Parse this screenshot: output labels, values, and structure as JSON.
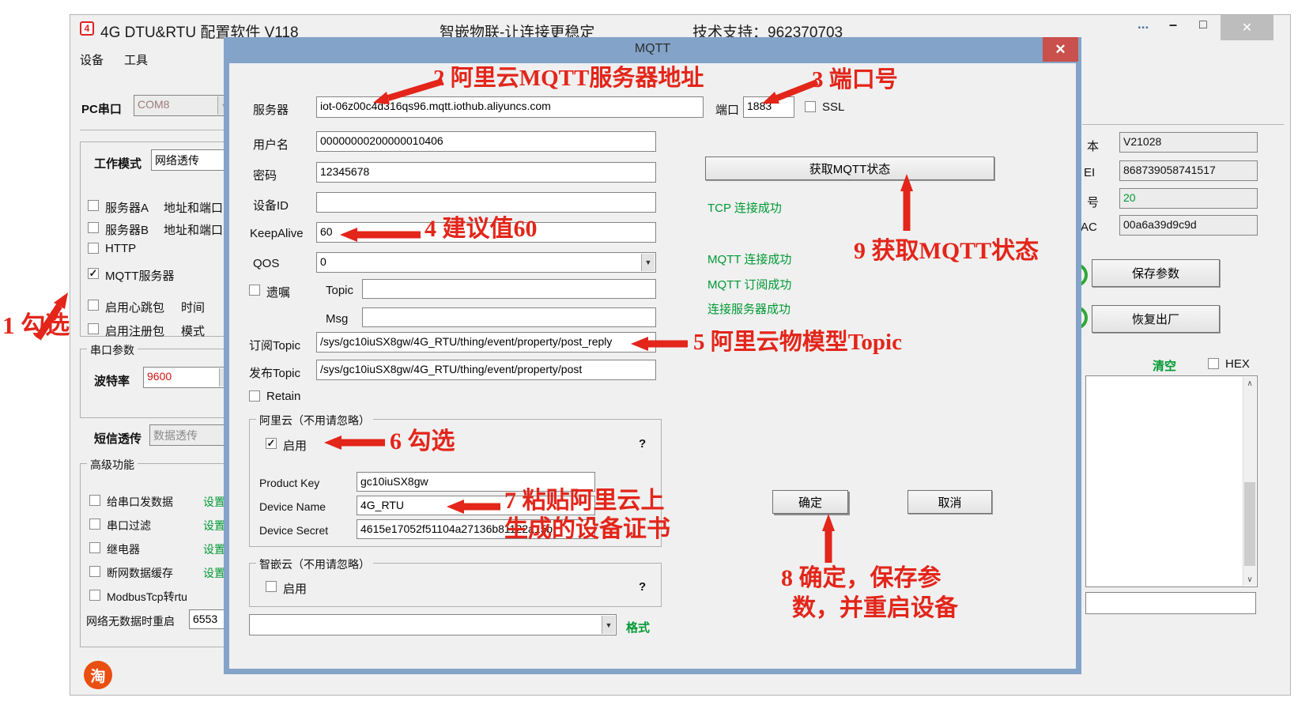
{
  "window": {
    "logo": "4",
    "title": "4G DTU&RTU 配置软件  V118",
    "subtitle": "智嵌物联-让连接更稳定",
    "support": "技术支持：962370703",
    "more": "...",
    "minimize": "–",
    "maximize": "□",
    "close": "✕",
    "menu": [
      {
        "label": "设备"
      },
      {
        "label": "工具"
      }
    ]
  },
  "icons": {
    "check": "✓",
    "dropdown_arrow": "▼",
    "help": "?",
    "scroll_up": "∧",
    "scroll_down": "∨",
    "taobao": "淘"
  },
  "left_panel": {
    "pc_serial_label": "PC串口",
    "pc_serial_value": "COM8",
    "work_mode_label": "工作模式",
    "work_mode_value": "网络透传",
    "server_a_label": "服务器A",
    "server_a_extra": "地址和端口",
    "server_b_label": "服务器B",
    "server_b_extra": "地址和端口",
    "http_label": "HTTP",
    "mqtt_server_label": "MQTT服务器",
    "heartbeat_label": "启用心跳包",
    "heartbeat_extra": "时间",
    "register_label": "启用注册包",
    "register_extra": "模式",
    "serial_group_title": "串口参数",
    "baud_label": "波特率",
    "baud_value": "9600",
    "sms_label": "短信透传",
    "sms_value": "数据透传",
    "advanced_group_title": "高级功能",
    "advanced_rows": [
      {
        "label": "给串口发数据",
        "link": "设置"
      },
      {
        "label": "串口过滤",
        "link": "设置"
      },
      {
        "label": "继电器",
        "link": "设置动"
      },
      {
        "label": "断网数据缓存",
        "link": "设置"
      },
      {
        "label": "ModbusTcp转rtu",
        "link": ""
      }
    ],
    "restart_label": "网络无数据时重启",
    "restart_value": "6553"
  },
  "dialog": {
    "title": "MQTT",
    "close": "✕",
    "server_label": "服务器",
    "server_value": "iot-06z00c4d316qs96.mqtt.iothub.aliyuncs.com",
    "port_label": "端口",
    "port_value": "1883",
    "ssl_label": "SSL",
    "username_label": "用户名",
    "username_value": "00000000200000010406",
    "password_label": "密码",
    "password_value": "12345678",
    "device_id_label": "设备ID",
    "device_id_value": "",
    "keepalive_label": "KeepAlive",
    "keepalive_value": "60",
    "qos_label": "QOS",
    "qos_value": "0",
    "will_label": "遗嘱",
    "will_topic_label": "Topic",
    "will_topic_value": "",
    "will_msg_label": "Msg",
    "will_msg_value": "",
    "sub_topic_label": "订阅Topic",
    "sub_topic_value": "/sys/gc10iuSX8gw/4G_RTU/thing/event/property/post_reply",
    "pub_topic_label": "发布Topic",
    "pub_topic_value": "/sys/gc10iuSX8gw/4G_RTU/thing/event/property/post",
    "retain_label": "Retain",
    "aliyun_group_title": "阿里云（不用请忽略）",
    "aliyun_enable_label": "启用",
    "product_key_label": "Product Key",
    "product_key_value": "gc10iuSX8gw",
    "device_name_label": "Device Name",
    "device_name_value": "4G_RTU",
    "device_secret_label": "Device Secret",
    "device_secret_value": "4615e17052f51104a27136b81122a15b",
    "zhiqian_group_title": "智嵌云（不用请忽略）",
    "zhiqian_enable_label": "启用",
    "format_label": "格式",
    "status_button": "获取MQTT状态",
    "status_lines": [
      {
        "text": "TCP 连接成功"
      },
      {
        "text": "MQTT 连接成功"
      },
      {
        "text": "MQTT 订阅成功"
      },
      {
        "text": "连接服务器成功"
      }
    ],
    "ok_button": "确定",
    "cancel_button": "取消"
  },
  "right_panel": {
    "version_label": "本",
    "version_value": "V21028",
    "imei_label": "EI",
    "imei_value": "868739058741517",
    "signal_label": "号",
    "signal_value": "20",
    "mac_label": "AC",
    "mac_value": "00a6a39d9c9d",
    "save_button": "保存参数",
    "factory_button": "恢复出厂",
    "clear_link": "清空",
    "hex_label": "HEX"
  },
  "annotations": {
    "a1": "1 勾选",
    "a2": "2 阿里云MQTT服务器地址",
    "a3": "3 端口号",
    "a4": "4 建议值60",
    "a5": "5 阿里云物模型Topic",
    "a6": "6 勾选",
    "a7_line1": "7 粘贴阿里云上",
    "a7_line2": "生成的设备证书",
    "a8_line1": "8 确定，保存参",
    "a8_line2": "数，并重启设备",
    "a9": "9 获取MQTT状态"
  },
  "colors": {
    "dialog_border": "#83a3c8",
    "annotation_red": "#e3251a",
    "status_green": "#009933",
    "close_red": "#c9504c",
    "taobao_orange": "#e94f10"
  }
}
